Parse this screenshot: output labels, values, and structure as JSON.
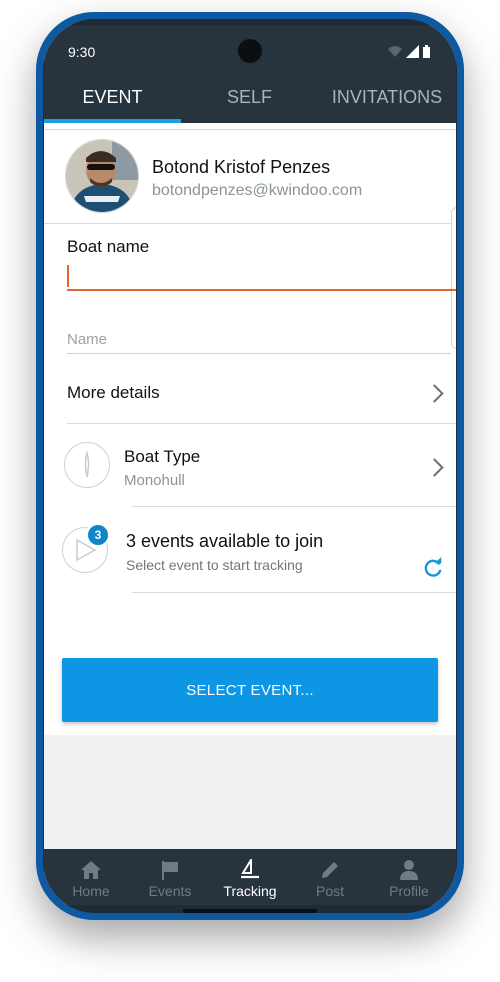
{
  "status_bar": {
    "time": "9:30"
  },
  "tabs": [
    {
      "label": "EVENT",
      "active": true
    },
    {
      "label": "SELF",
      "active": false
    },
    {
      "label": "INVITATIONS",
      "active": false
    }
  ],
  "user": {
    "name": "Botond Kristof Penzes",
    "email": "botondpenzes@kwindoo.com"
  },
  "form": {
    "boat_name_label": "Boat name",
    "boat_name_value": "",
    "name_placeholder": "Name"
  },
  "more_details": {
    "label": "More details"
  },
  "boat_type": {
    "label": "Boat Type",
    "value": "Monohull"
  },
  "events": {
    "badge_count": "3",
    "title": "3 events available to join",
    "subtitle": "Select event to start tracking"
  },
  "select_button": {
    "label": "SELECT EVENT..."
  },
  "bottom_nav": [
    {
      "label": "Home",
      "icon": "home-icon",
      "active": false
    },
    {
      "label": "Events",
      "icon": "flag-icon",
      "active": false
    },
    {
      "label": "Tracking",
      "icon": "sailboat-icon",
      "active": true
    },
    {
      "label": "Post",
      "icon": "pencil-icon",
      "active": false
    },
    {
      "label": "Profile",
      "icon": "person-icon",
      "active": false
    }
  ],
  "colors": {
    "accent": "#0d96e3",
    "header": "#27333d",
    "input_focus": "#e0672e",
    "frame": "#0d5aa3"
  }
}
